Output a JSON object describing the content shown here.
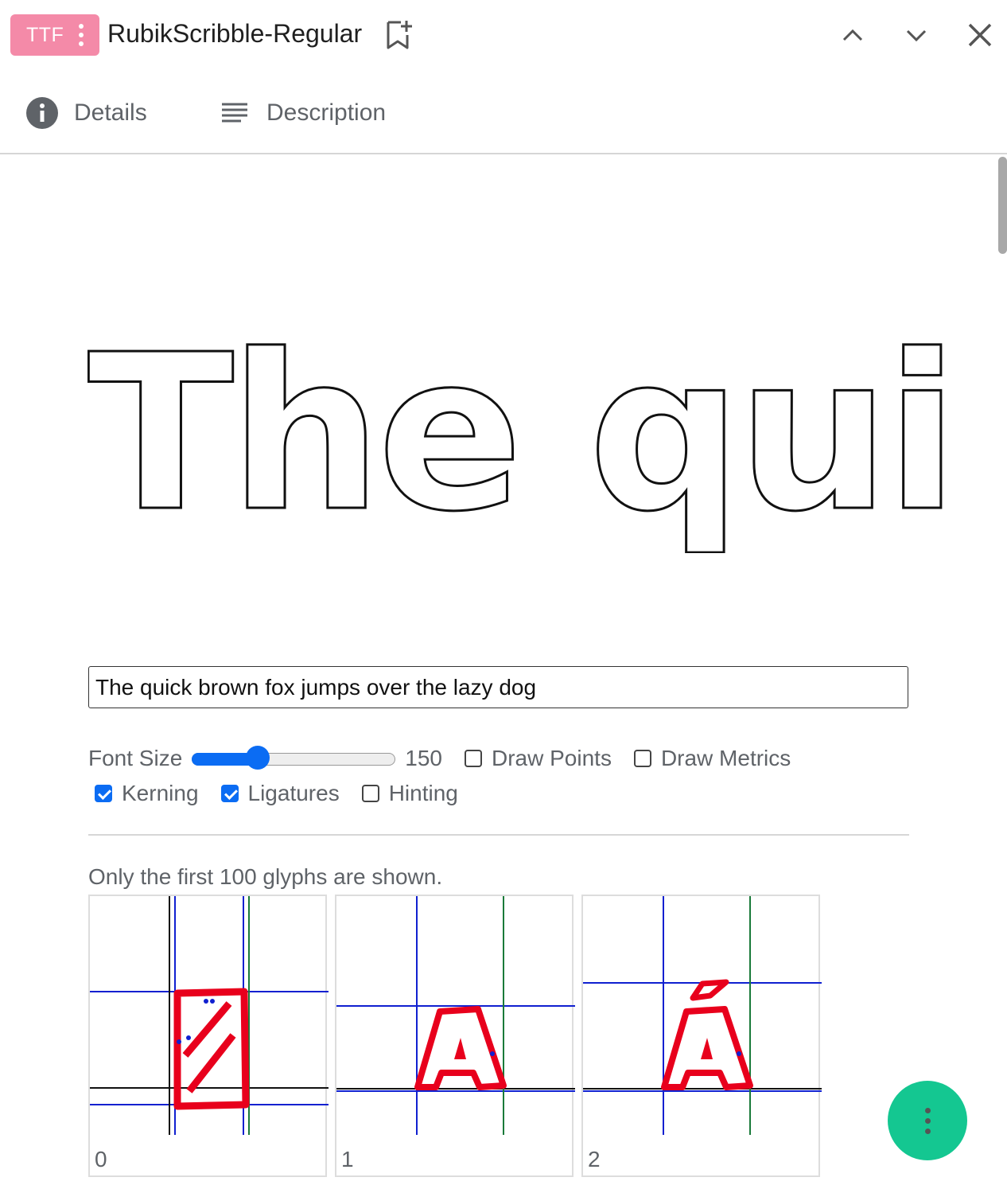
{
  "header": {
    "badge_label": "TTF",
    "font_name": "RubikScribble-Regular",
    "icons": [
      "more-vert-icon",
      "bookmark-add-icon",
      "chevron-up-icon",
      "chevron-down-icon",
      "close-icon"
    ],
    "badge_color": "#f48aa8"
  },
  "tabs": [
    {
      "label": "Details",
      "icon": "info-icon"
    },
    {
      "label": "Description",
      "icon": "text-lines-icon"
    }
  ],
  "preview": {
    "visible_text": "The qui"
  },
  "sample_input": {
    "value": "The quick brown fox jumps over the lazy dog"
  },
  "controls": {
    "font_size_label": "Font Size",
    "font_size_value": "150",
    "font_size_fraction": 0.3,
    "draw_points_label": "Draw Points",
    "draw_points_checked": false,
    "draw_metrics_label": "Draw Metrics",
    "draw_metrics_checked": false,
    "kerning_label": "Kerning",
    "kerning_checked": true,
    "ligatures_label": "Ligatures",
    "ligatures_checked": true,
    "hinting_label": "Hinting",
    "hinting_checked": false
  },
  "glyphs": {
    "note": "Only the first 100 glyphs are shown.",
    "items": [
      {
        "index": "0",
        "char": ""
      },
      {
        "index": "1",
        "char": "A"
      },
      {
        "index": "2",
        "char": "Á"
      }
    ]
  },
  "colors": {
    "accent": "#0b6cf3",
    "fab": "#14c791",
    "glyph_outline": "#e8001c",
    "metric_line": "#1020d0",
    "advance_line": "#1a7a3a"
  },
  "fab": {
    "icon": "more-vert-icon"
  }
}
